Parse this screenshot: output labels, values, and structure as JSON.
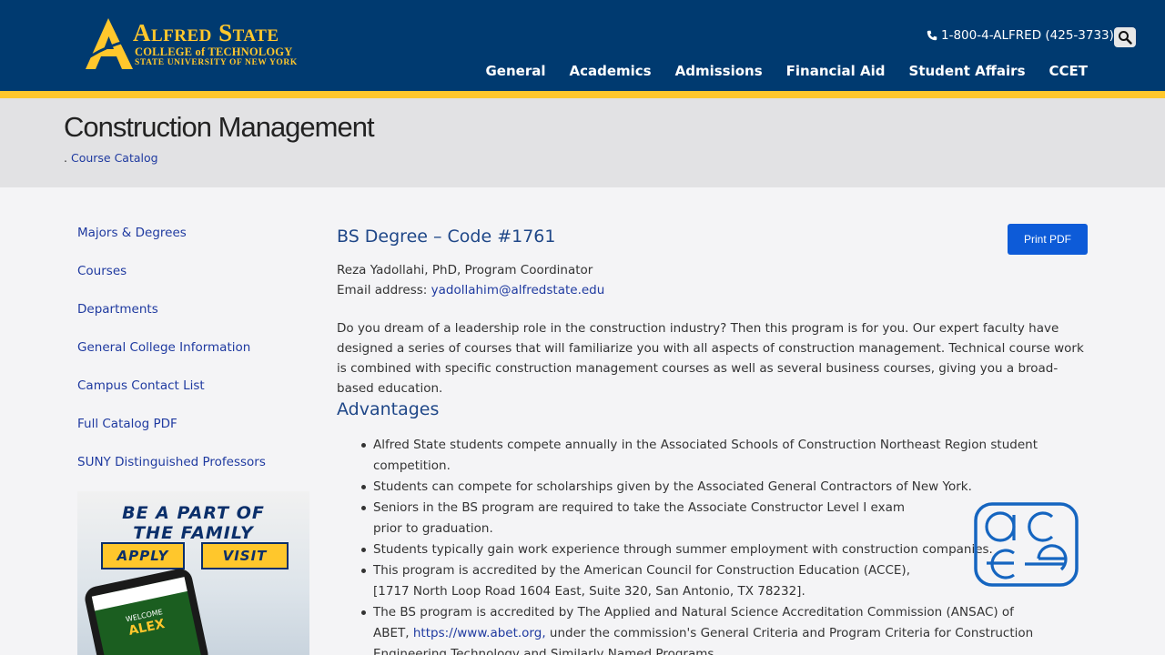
{
  "header": {
    "logo": {
      "line1": "Alfred State",
      "line2": "COLLEGE of TECHNOLOGY",
      "line3": "STATE UNIVERSITY OF NEW YORK"
    },
    "phone": "1-800-4-ALFRED (425-3733)",
    "nav": [
      "General",
      "Academics",
      "Admissions",
      "Financial Aid",
      "Student Affairs",
      "CCET"
    ],
    "colors": {
      "navy": "#003a70",
      "gold": "#ffc72c"
    }
  },
  "title_band": {
    "title": "Construction Management",
    "breadcrumb_prefix": ".",
    "breadcrumb_link": "Course Catalog"
  },
  "sidebar": {
    "items": [
      "Majors & Degrees",
      "Courses",
      "Departments",
      "General College Information",
      "Campus Contact List",
      "Full Catalog PDF",
      "SUNY Distinguished Professors"
    ],
    "promo": {
      "line1": "BE A PART OF",
      "line2": "THE FAMILY",
      "apply": "APPLY",
      "visit": "VISIT",
      "screen_welcome": "WELCOME",
      "screen_name": "ALEX"
    }
  },
  "main": {
    "degree_heading": "BS Degree – Code #1761",
    "print_button": "Print PDF",
    "coordinator": "Reza Yadollahi, PhD, Program Coordinator",
    "email_label": "Email address:",
    "email": "yadollahim@alfredstate.edu",
    "intro": "Do you dream of a leadership role in the construction industry? Then this program is for you. Our expert faculty have designed a series of courses that will familiarize you with all aspects of construction management. Technical course work is combined with specific construction management courses as well as several business courses, giving you a broad-based education.",
    "advantages_heading": "Advantages",
    "advantages": [
      "Alfred State students compete annually in the Associated Schools of Construction Northeast Region student competition.",
      "Students can compete for scholarships given by the Associated General Contractors of New York.",
      "Seniors in the BS program are required to take the Associate Constructor Level I exam prior to graduation.",
      "Students typically gain work experience through summer employment with construction companies.",
      "This program is accredited by the American Council for Construction Education (ACCE), [1717 North Loop Road 1604 East, Suite 320, San Antonio, TX 78232]."
    ],
    "advantage_last": {
      "before": "The BS program is accredited by The Applied and Natural Science Accreditation Commission (ANSAC) of ABET,",
      "link": "https://www.abet.org,",
      "after": " under the commission's General Criteria and Program Criteria for Construction Engineering Technology and Similarly Named Programs."
    },
    "acce_logo": "acce"
  }
}
